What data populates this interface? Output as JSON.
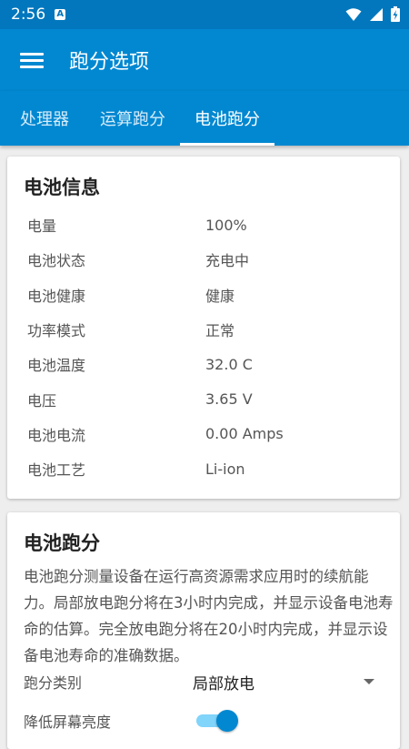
{
  "status_bar": {
    "time": "2:56",
    "notif_letter": "A"
  },
  "app_bar": {
    "title": "跑分选项",
    "menu_icon": "hamburger-menu-icon"
  },
  "tabs": [
    {
      "label": "处理器",
      "selected": false
    },
    {
      "label": "运算跑分",
      "selected": false
    },
    {
      "label": "电池跑分",
      "selected": true
    }
  ],
  "battery_info": {
    "title": "电池信息",
    "rows": [
      {
        "label": "电量",
        "value": "100%"
      },
      {
        "label": "电池状态",
        "value": "充电中"
      },
      {
        "label": "电池健康",
        "value": "健康"
      },
      {
        "label": "功率模式",
        "value": "正常"
      },
      {
        "label": "电池温度",
        "value": "32.0 C"
      },
      {
        "label": "电压",
        "value": "3.65 V"
      },
      {
        "label": "电池电流",
        "value": "0.00 Amps"
      },
      {
        "label": "电池工艺",
        "value": "Li-ion"
      }
    ]
  },
  "battery_benchmark": {
    "title": "电池跑分",
    "description": "电池跑分测量设备在运行高资源需求应用时的续航能力。局部放电跑分将在3小时内完成，并显示设备电池寿命的估算。完全放电跑分将在20小时内完成，并显示设备电池寿命的准确数据。",
    "type_label": "跑分类别",
    "type_value": "局部放电",
    "dim_label": "降低屏幕亮度",
    "dim_enabled": true
  },
  "colors": {
    "primary": "#0288d1",
    "status_bar": "#0277bd",
    "accent_track": "#81d4fa"
  }
}
